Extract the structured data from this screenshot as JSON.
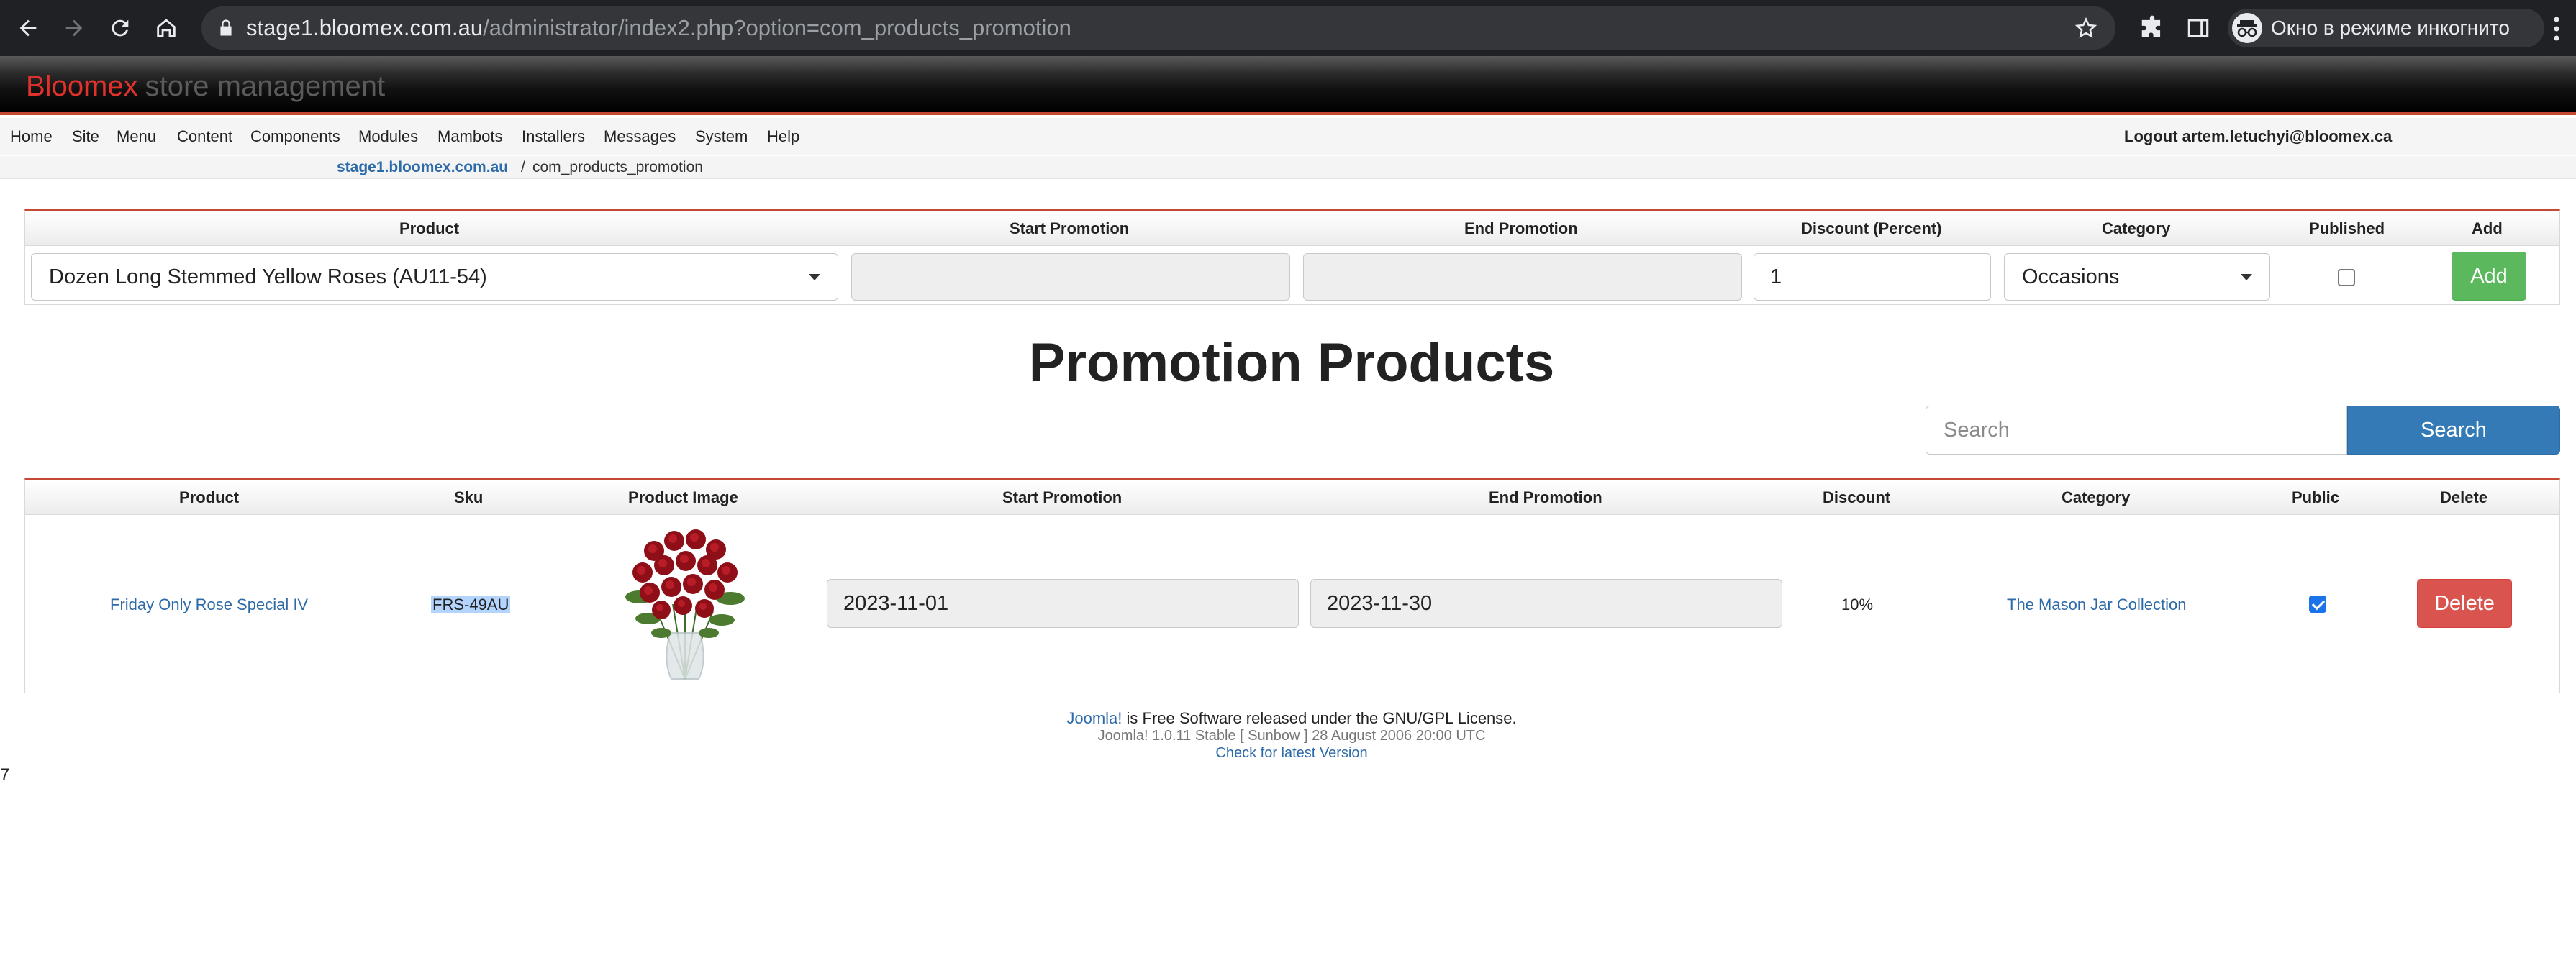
{
  "browser": {
    "url_host": "stage1.bloomex.com.au",
    "url_path": "/administrator/index2.php?option=com_products_promotion",
    "incognito_label": "Окно в режиме инкогнито"
  },
  "header": {
    "brand_red": "Bloomex",
    "brand_grey": "store management"
  },
  "menubar": {
    "items": [
      "Home",
      "Site",
      "Menu",
      "Content",
      "Components",
      "Modules",
      "Mambots",
      "Installers",
      "Messages",
      "System",
      "Help"
    ],
    "logout": "Logout artem.letuchyi@bloomex.ca"
  },
  "pathway": {
    "site": "stage1.bloomex.com.au",
    "separator": "/",
    "page": "com_products_promotion"
  },
  "add_form": {
    "headers": {
      "product": "Product",
      "start": "Start Promotion",
      "end": "End Promotion",
      "discount": "Discount (Percent)",
      "category": "Category",
      "published": "Published",
      "add": "Add"
    },
    "product_value": "Dozen Long Stemmed Yellow Roses (AU11-54)",
    "start_value": "",
    "end_value": "",
    "discount_value": "1",
    "category_value": "Occasions",
    "published": false,
    "add_button": "Add"
  },
  "title": "Promotion Products",
  "search": {
    "placeholder": "Search",
    "button": "Search"
  },
  "list": {
    "headers": {
      "product": "Product",
      "sku": "Sku",
      "image": "Product Image",
      "start": "Start Promotion",
      "end": "End Promotion",
      "discount": "Discount",
      "category": "Category",
      "public": "Public",
      "delete": "Delete"
    },
    "rows": [
      {
        "product": "Friday Only Rose Special IV",
        "sku": "FRS-49AU",
        "start": "2023-11-01",
        "end": "2023-11-30",
        "discount": "10%",
        "category": "The Mason Jar Collection",
        "public": true,
        "delete_button": "Delete"
      }
    ]
  },
  "footer": {
    "joomla_link": "Joomla!",
    "license": " is Free Software released under the GNU/GPL License.",
    "version": "Joomla! 1.0.11 Stable [ Sunbow ] 28 August 2006 20:00 UTC",
    "check": "Check for latest Version"
  },
  "stray_text": "7",
  "colors": {
    "accent_red": "#c64934",
    "link_blue": "#2d6aa8",
    "add_green": "#5cb85c",
    "search_blue": "#337ab7",
    "delete_red": "#d9534f"
  }
}
